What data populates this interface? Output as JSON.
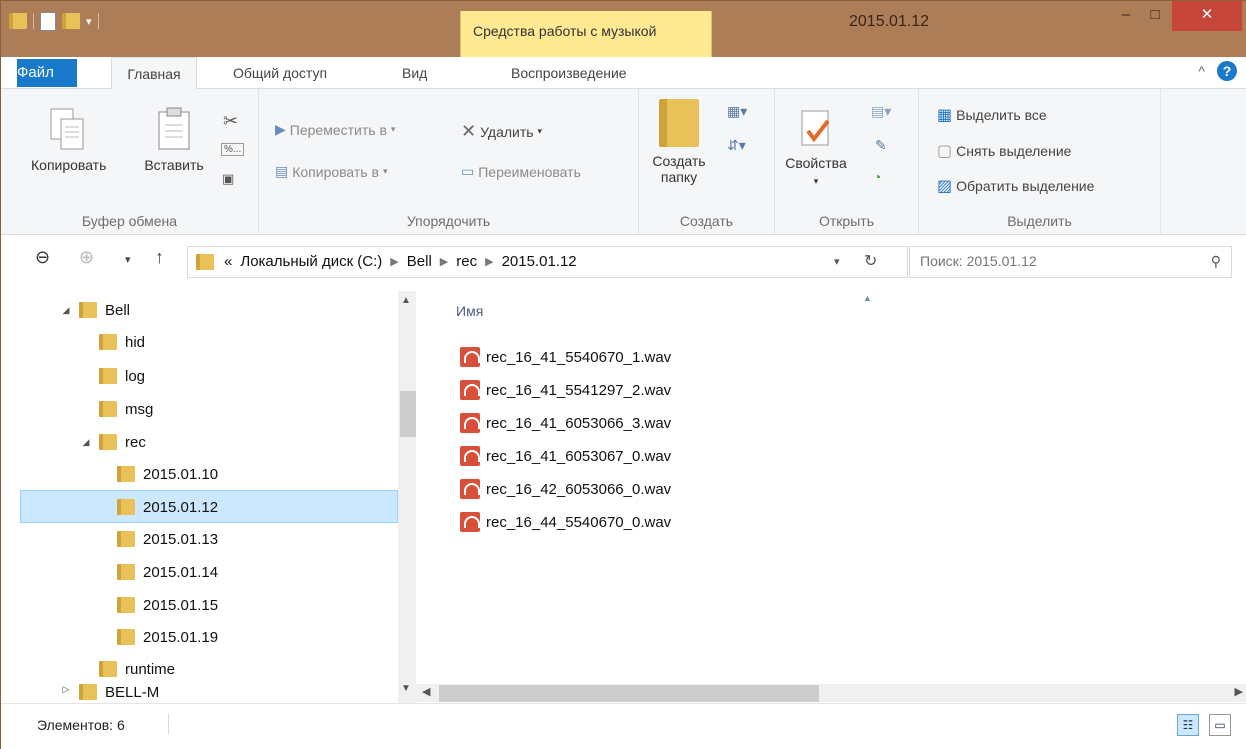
{
  "window": {
    "title": "2015.01.12",
    "context_tab": "Средства работы с музыкой",
    "minimize": "–",
    "maximize": "□",
    "close": "✕"
  },
  "tabs": {
    "file": "Файл",
    "home": "Главная",
    "share": "Общий доступ",
    "view": "Вид",
    "playback": "Воспроизведение",
    "help": "?",
    "collapse": "^"
  },
  "ribbon": {
    "clipboard": {
      "label": "Буфер обмена",
      "copy": "Копировать",
      "paste": "Вставить"
    },
    "organize": {
      "label": "Упорядочить",
      "move_to": "Переместить в",
      "copy_to": "Копировать в",
      "delete": "Удалить",
      "rename": "Переименовать"
    },
    "new": {
      "label": "Создать",
      "new_folder_line1": "Создать",
      "new_folder_line2": "папку"
    },
    "open": {
      "label": "Открыть",
      "properties": "Свойства"
    },
    "select": {
      "label": "Выделить",
      "select_all": "Выделить все",
      "select_none": "Снять выделение",
      "invert": "Обратить выделение"
    }
  },
  "address": {
    "overflow": "«",
    "crumbs": [
      "Локальный диск (C:)",
      "Bell",
      "rec",
      "2015.01.12"
    ],
    "search_placeholder": "Поиск: 2015.01.12"
  },
  "tree": {
    "items": [
      "Bell",
      "hid",
      "log",
      "msg",
      "rec",
      "2015.01.10",
      "2015.01.12",
      "2015.01.13",
      "2015.01.14",
      "2015.01.15",
      "2015.01.19",
      "runtime",
      "BELL-M"
    ]
  },
  "files": {
    "column_name": "Имя",
    "items": [
      "rec_16_41_5540670_1.wav",
      "rec_16_41_5541297_2.wav",
      "rec_16_41_6053066_3.wav",
      "rec_16_41_6053067_0.wav",
      "rec_16_42_6053066_0.wav",
      "rec_16_44_5540670_0.wav"
    ]
  },
  "status": {
    "items_count": "Элементов: 6"
  }
}
